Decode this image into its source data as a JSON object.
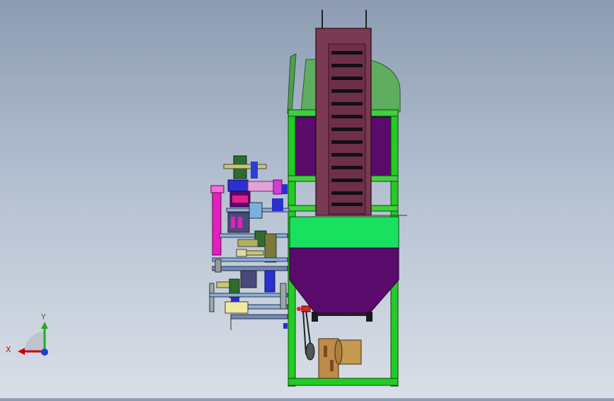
{
  "viewport": {
    "background_top": "#8d9cb3",
    "background_bottom": "#d9dfe8"
  },
  "model": {
    "frame_color": "#22cc22",
    "hopper_band_color": "#19e05f",
    "hopper_color": "#5a0a6b",
    "elevator_color": "#7a3a52",
    "cover_color": "#5fae5f",
    "pink_color": "#e31fbf",
    "motor_color": "#c08a4a"
  },
  "triad": {
    "x_label": "X",
    "y_label": "Y",
    "x_color": "#cc0000",
    "y_color": "#22aa22",
    "z_color": "#1a3fd0"
  }
}
